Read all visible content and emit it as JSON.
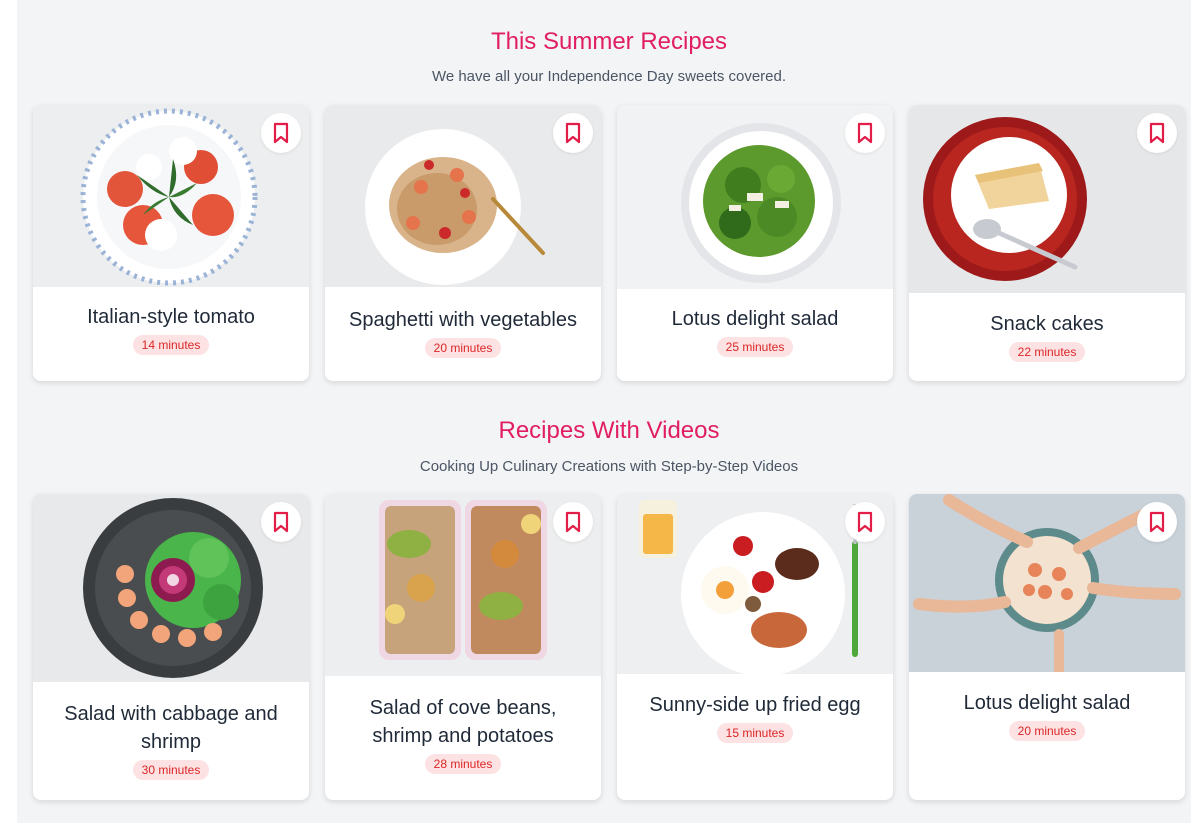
{
  "sections": [
    {
      "title": "This Summer Recipes",
      "subtitle": "We have all your Independence Day sweets covered.",
      "cards": [
        {
          "title": "Italian-style tomato",
          "time": "14 minutes"
        },
        {
          "title": "Spaghetti with vegetables",
          "time": "20 minutes"
        },
        {
          "title": "Lotus delight salad",
          "time": "25 minutes"
        },
        {
          "title": "Snack cakes",
          "time": "22 minutes"
        }
      ]
    },
    {
      "title": "Recipes With Videos",
      "subtitle": "Cooking Up Culinary Creations with Step-by-Step Videos",
      "cards": [
        {
          "title": "Salad with cabbage and shrimp",
          "time": "30 minutes"
        },
        {
          "title": "Salad of cove beans, shrimp and potatoes",
          "time": "28 minutes"
        },
        {
          "title": "Sunny-side up fried egg",
          "time": "15 minutes"
        },
        {
          "title": "Lotus delight salad",
          "time": "20 minutes"
        }
      ]
    }
  ],
  "icons": {
    "bookmark": "bookmark-icon"
  },
  "colors": {
    "accent": "#e11d63",
    "badge_bg": "#fde2e4",
    "badge_text": "#dc2626",
    "bookmark": "#e11d48"
  }
}
